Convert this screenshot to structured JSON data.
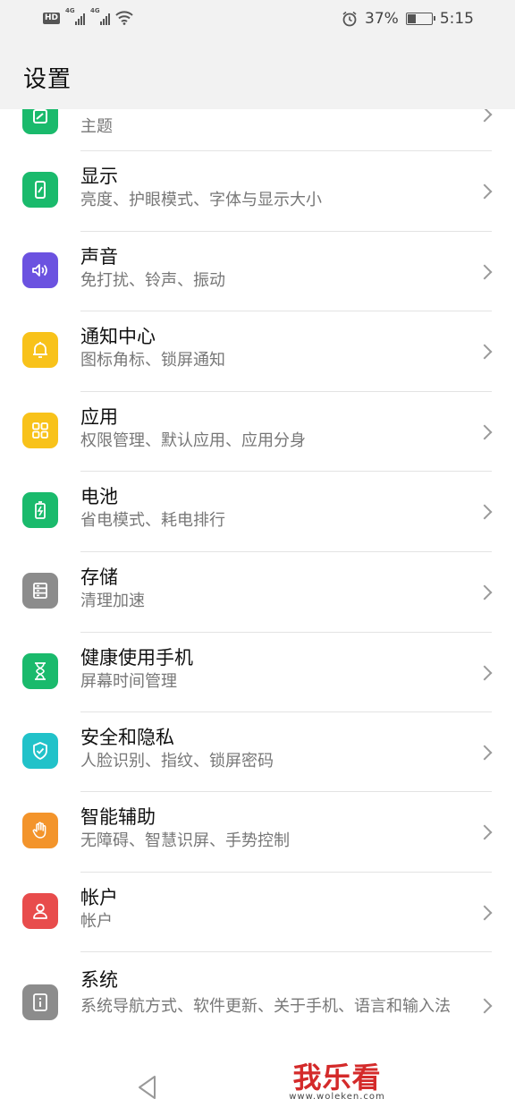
{
  "status_bar": {
    "signal_tag_1": "4G",
    "signal_tag_2": "4G",
    "battery_percent": "37%",
    "battery_level": 0.37,
    "time": "5:15"
  },
  "header": {
    "title": "设置"
  },
  "settings_items": [
    {
      "label": "",
      "subtitle": "主题",
      "icon": "theme-icon",
      "color": "#1aba6c"
    },
    {
      "label": "显示",
      "subtitle": "亮度、护眼模式、字体与显示大小",
      "icon": "display-icon",
      "color": "#1aba6c"
    },
    {
      "label": "声音",
      "subtitle": "免打扰、铃声、振动",
      "icon": "sound-icon",
      "color": "#6b52e0"
    },
    {
      "label": "通知中心",
      "subtitle": "图标角标、锁屏通知",
      "icon": "bell-icon",
      "color": "#f8c21a"
    },
    {
      "label": "应用",
      "subtitle": "权限管理、默认应用、应用分身",
      "icon": "apps-grid-icon",
      "color": "#f8c21a"
    },
    {
      "label": "电池",
      "subtitle": "省电模式、耗电排行",
      "icon": "battery-icon",
      "color": "#1aba6c"
    },
    {
      "label": "存储",
      "subtitle": "清理加速",
      "icon": "storage-icon",
      "color": "#8c8c8c"
    },
    {
      "label": "健康使用手机",
      "subtitle": "屏幕时间管理",
      "icon": "hourglass-icon",
      "color": "#1aba6c"
    },
    {
      "label": "安全和隐私",
      "subtitle": "人脸识别、指纹、锁屏密码",
      "icon": "shield-icon",
      "color": "#21c2c9"
    },
    {
      "label": "智能辅助",
      "subtitle": "无障碍、智慧识屏、手势控制",
      "icon": "hand-icon",
      "color": "#f3942b"
    },
    {
      "label": "帐户",
      "subtitle": "帐户",
      "icon": "person-icon",
      "color": "#e84c4c"
    },
    {
      "label": "系统",
      "subtitle": "系统导航方式、软件更新、关于手机、语言和输入法",
      "icon": "info-icon",
      "color": "#8c8c8c"
    }
  ],
  "watermark": {
    "logo": "我乐看",
    "url": "www.woleken.com"
  }
}
